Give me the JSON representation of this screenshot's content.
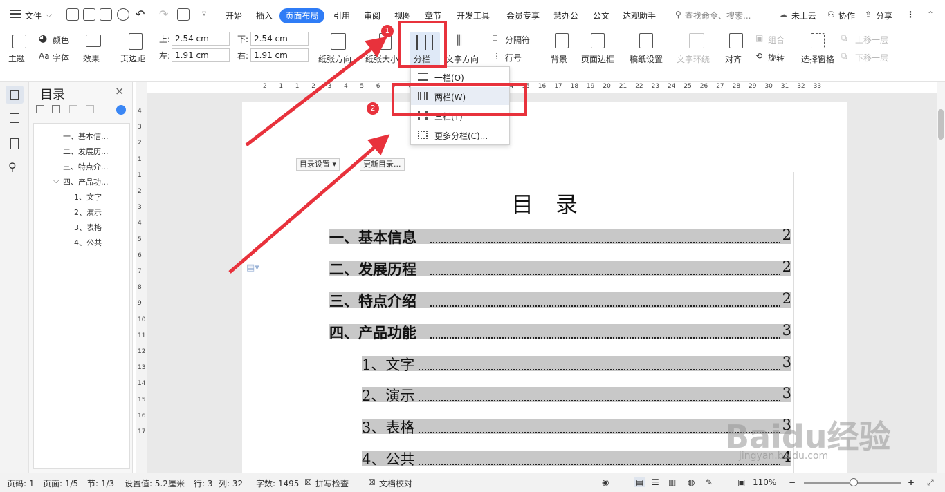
{
  "menubar": {
    "file": "文件",
    "tabs": [
      "开始",
      "插入",
      "页面布局",
      "引用",
      "审阅",
      "视图",
      "章节",
      "开发工具",
      "会员专享",
      "慧办公",
      "公文",
      "达观助手"
    ],
    "search_placeholder": "查找命令、搜索...",
    "cloud": "未上云",
    "collab": "协作",
    "share": "分享"
  },
  "ribbon": {
    "theme": "主题",
    "color": "颜色",
    "font": "字体",
    "effect": "效果",
    "margin": "页边距",
    "top_label": "上:",
    "top_value": "2.54 cm",
    "bottom_label": "下:",
    "bottom_value": "2.54 cm",
    "left_label": "左:",
    "left_value": "1.91 cm",
    "right_label": "右:",
    "right_value": "1.91 cm",
    "orientation": "纸张方向",
    "paper_size": "纸张大小",
    "columns": "分栏",
    "text_direction": "文字方向",
    "separator": "分隔符",
    "line_number": "行号",
    "background": "背景",
    "page_border": "页面边框",
    "draft_settings": "稿纸设置",
    "text_wrap": "文字环绕",
    "align": "对齐",
    "group": "组合",
    "rotate": "旋转",
    "selection_pane": "选择窗格",
    "bring_forward": "上移一层",
    "send_backward": "下移一层"
  },
  "columns_menu": {
    "items": [
      "一栏(O)",
      "两栏(W)",
      "三栏(T)",
      "更多分栏(C)..."
    ]
  },
  "toc_panel": {
    "title": "目录",
    "items": [
      "一、基本信...",
      "二、发展历...",
      "三、特点介...",
      "四、产品功...",
      "1、文字",
      "2、演示",
      "3、表格",
      "4、公共"
    ]
  },
  "document": {
    "toc_settings": "目录设置",
    "update_toc": "更新目录...",
    "title": "目　录",
    "entries": [
      {
        "text": "一、基本信息",
        "page": "2"
      },
      {
        "text": "二、发展历程",
        "page": "2"
      },
      {
        "text": "三、特点介绍",
        "page": "2"
      },
      {
        "text": "四、产品功能",
        "page": "3"
      },
      {
        "text": "1、文字",
        "page": "3"
      },
      {
        "text": "2、演示",
        "page": "3"
      },
      {
        "text": "3、表格",
        "page": "3"
      },
      {
        "text": "4、公共",
        "page": "4"
      }
    ]
  },
  "ruler": {
    "h": [
      "2",
      "1",
      "1",
      "2",
      "3",
      "4",
      "5",
      "6",
      "7",
      "8",
      "9",
      "10",
      "11",
      "12",
      "13",
      "14",
      "15",
      "16",
      "17",
      "18",
      "19",
      "20",
      "21",
      "22",
      "23",
      "24",
      "25",
      "26",
      "27",
      "28",
      "29",
      "30",
      "31",
      "32",
      "33"
    ],
    "v": [
      "4",
      "3",
      "2",
      "1",
      "1",
      "2",
      "3",
      "4",
      "5",
      "6",
      "7",
      "8",
      "9",
      "10",
      "11",
      "12",
      "13",
      "14",
      "15",
      "16",
      "17"
    ]
  },
  "status": {
    "page_num": "页码: 1",
    "pages": "页面: 1/5",
    "section": "节: 1/3",
    "setting": "设置值: 5.2厘米",
    "row": "行: 3",
    "col": "列: 32",
    "words": "字数: 1495",
    "spell": "拼写检查",
    "proof": "文档校对",
    "zoom": "110%"
  },
  "annotations": {
    "badge1": "1",
    "badge2": "2"
  },
  "watermark": {
    "logo": "Baidu经验",
    "url": "jingyan.baidu.com"
  },
  "colors": {
    "accent": "#2f7cf6",
    "annotation": "#e8323c",
    "highlight": "#c8c8c8"
  }
}
